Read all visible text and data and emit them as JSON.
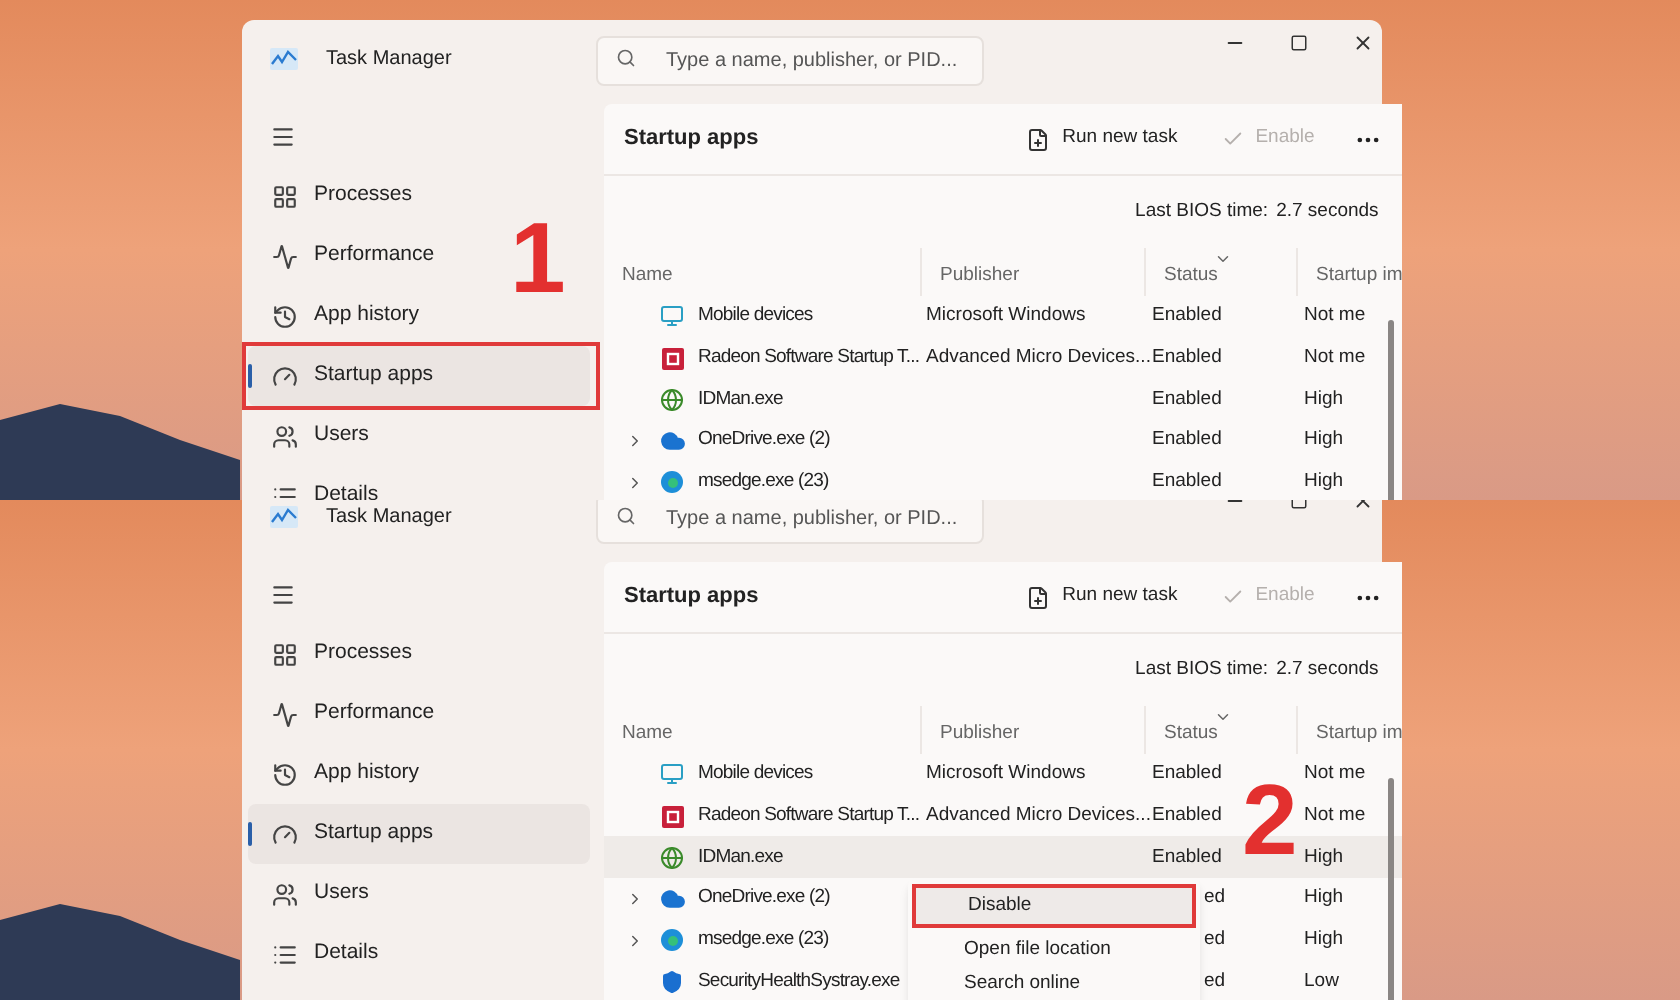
{
  "panels": [
    {
      "step_marker": {
        "text": "1"
      },
      "window": {
        "title": "Task Manager",
        "search_placeholder": "Type a name, publisher, or PID...",
        "nav": [
          {
            "label": "Processes",
            "selected": false,
            "highlighted": false
          },
          {
            "label": "Performance",
            "selected": false,
            "highlighted": false
          },
          {
            "label": "App history",
            "selected": false,
            "highlighted": false
          },
          {
            "label": "Startup apps",
            "selected": true,
            "highlighted": true
          },
          {
            "label": "Users",
            "selected": false,
            "highlighted": false
          },
          {
            "label": "Details",
            "selected": false,
            "highlighted": false
          }
        ],
        "page_title": "Startup apps",
        "run_new_task": "Run new task",
        "enable": {
          "label": "Enable",
          "disabled": true
        },
        "bios_label": "Last BIOS time:",
        "bios_value": "2.7 seconds",
        "columns": [
          {
            "label": "Name",
            "sorted": false
          },
          {
            "label": "Publisher",
            "sorted": false
          },
          {
            "label": "Status",
            "sorted": true
          },
          {
            "label": "Startup im",
            "sorted": false
          }
        ],
        "rows": [
          {
            "name": "Mobile devices",
            "publisher": "Microsoft Windows",
            "status": "Enabled",
            "impact": "Not me",
            "expandable": false,
            "selected": false
          },
          {
            "name": "Radeon Software Startup T...",
            "publisher": "Advanced Micro Devices...",
            "status": "Enabled",
            "impact": "Not me",
            "expandable": false,
            "selected": false
          },
          {
            "name": "IDMan.exe",
            "status": "Enabled",
            "impact": "High",
            "expandable": false,
            "selected": false
          },
          {
            "name": "OneDrive.exe (2)",
            "status": "Enabled",
            "impact": "High",
            "expandable": true,
            "selected": false
          },
          {
            "name": "msedge.exe (23)",
            "status": "Enabled",
            "impact": "High",
            "expandable": true,
            "selected": false
          }
        ]
      }
    },
    {
      "step_marker": {
        "text": "2"
      },
      "window": {
        "title": "Task Manager",
        "search_placeholder": "Type a name, publisher, or PID...",
        "nav": [
          {
            "label": "Processes",
            "selected": false,
            "highlighted": false
          },
          {
            "label": "Performance",
            "selected": false,
            "highlighted": false
          },
          {
            "label": "App history",
            "selected": false,
            "highlighted": false
          },
          {
            "label": "Startup apps",
            "selected": true,
            "highlighted": false
          },
          {
            "label": "Users",
            "selected": false,
            "highlighted": false
          },
          {
            "label": "Details",
            "selected": false,
            "highlighted": false
          }
        ],
        "page_title": "Startup apps",
        "run_new_task": "Run new task",
        "enable": {
          "label": "Enable",
          "disabled": true
        },
        "bios_label": "Last BIOS time:",
        "bios_value": "2.7 seconds",
        "columns": [
          {
            "label": "Name",
            "sorted": false
          },
          {
            "label": "Publisher",
            "sorted": false
          },
          {
            "label": "Status",
            "sorted": true
          },
          {
            "label": "Startup im",
            "sorted": false
          }
        ],
        "rows": [
          {
            "name": "Mobile devices",
            "publisher": "Microsoft Windows",
            "status": "Enabled",
            "impact": "Not me",
            "expandable": false,
            "selected": false
          },
          {
            "name": "Radeon Software Startup T...",
            "publisher": "Advanced Micro Devices...",
            "status": "Enabled",
            "impact": "Not me",
            "expandable": false,
            "selected": false
          },
          {
            "name": "IDMan.exe",
            "status": "Enabled",
            "impact": "High",
            "expandable": false,
            "selected": true,
            "context_menu": [
              {
                "label": "Disable",
                "highlighted": true
              },
              {
                "label": "Open file location",
                "highlighted": false
              },
              {
                "label": "Search online",
                "highlighted": false
              }
            ]
          },
          {
            "name": "OneDrive.exe (2)",
            "status": "ed",
            "impact": "High",
            "expandable": true,
            "selected": false
          },
          {
            "name": "msedge.exe (23)",
            "status": "ed",
            "impact": "High",
            "expandable": true,
            "selected": false
          },
          {
            "name": "SecurityHealthSystray.exe",
            "status": "ed",
            "impact": "Low",
            "expandable": false,
            "selected": false
          }
        ]
      }
    }
  ]
}
